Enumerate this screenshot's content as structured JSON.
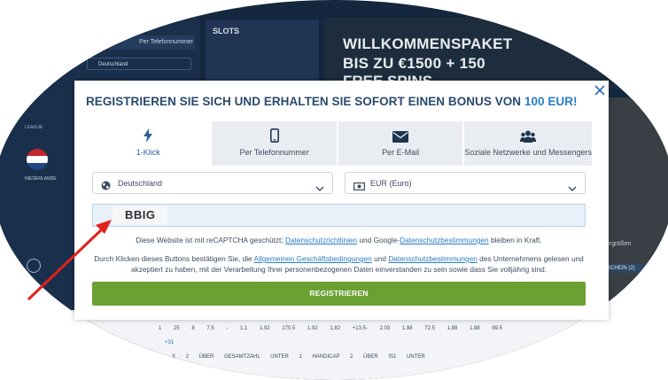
{
  "background": {
    "left_panel": {
      "tab_label": "Per Telefonnummer",
      "country": "Deutschland",
      "league": "LEAGUE",
      "team": "NIEDERLANDE"
    },
    "slots_label": "SLOTS",
    "promo_lines": [
      "WILLKOMMENSPAKET",
      "BIS ZU €1500 + 150",
      "FREE SPINS"
    ],
    "right_panel": {
      "schein_label": "SCHEIN (2)",
      "vergross_label": "ergrößen"
    },
    "table": {
      "row1": "1 25 8 7.5 - 1.1 1.92 170.5 1.92 1.82 +13.5- 2.03 1.88 72.5 1.88 1.88 89.5",
      "row2": "+31",
      "row3": "1 X 2 ÜBER GESAMTZAHL UNTER 1 HANDICAP 2 ÜBER IS1 UNTER"
    }
  },
  "modal": {
    "close_icon": "close-icon",
    "title_main": "REGISTRIEREN SIE SICH UND ERHALTEN SIE SOFORT EINEN BONUS VON ",
    "title_amount": "100 EUR!",
    "tabs": [
      {
        "label": "1-Klick",
        "icon": "lightning-icon",
        "active": true
      },
      {
        "label": "Per Telefonnummer",
        "icon": "phone-icon",
        "active": false
      },
      {
        "label": "Per E-Mail",
        "icon": "envelope-icon",
        "active": false
      },
      {
        "label": "Soziale Netzwerke und Messengers",
        "icon": "people-icon",
        "active": false
      }
    ],
    "country_select": "Deutschland",
    "currency_select": "EUR (Euro)",
    "promo_code": "BBIG",
    "recaptcha": {
      "prefix": "Diese Website ist mit reCAPTCHA geschützt; ",
      "link1": "Datenschutzrichtlinien",
      "middle": " und Google-",
      "link2": "Datenschutzbestimmungen",
      "suffix": " bleiben in Kraft."
    },
    "terms": {
      "prefix": "Durch Klicken dieses Buttons bestätigen Sie, die ",
      "link1": "Allgemeinen Geschäftsbedingungen",
      "middle": " und ",
      "link2": "Datenschutzbestimmungen",
      "suffix": " des Unternehmens gelesen und akzeptiert zu haben, mit der Verarbeitung Ihrer personenbezogenen Daten einverstanden zu sein sowie dass Sie volljährig sind."
    },
    "register_button": "REGISTRIEREN"
  },
  "colors": {
    "accent": "#2a7cc4",
    "title": "#2b4a6e",
    "register_button": "#6ba032",
    "annotation_arrow": "#e0201b"
  }
}
